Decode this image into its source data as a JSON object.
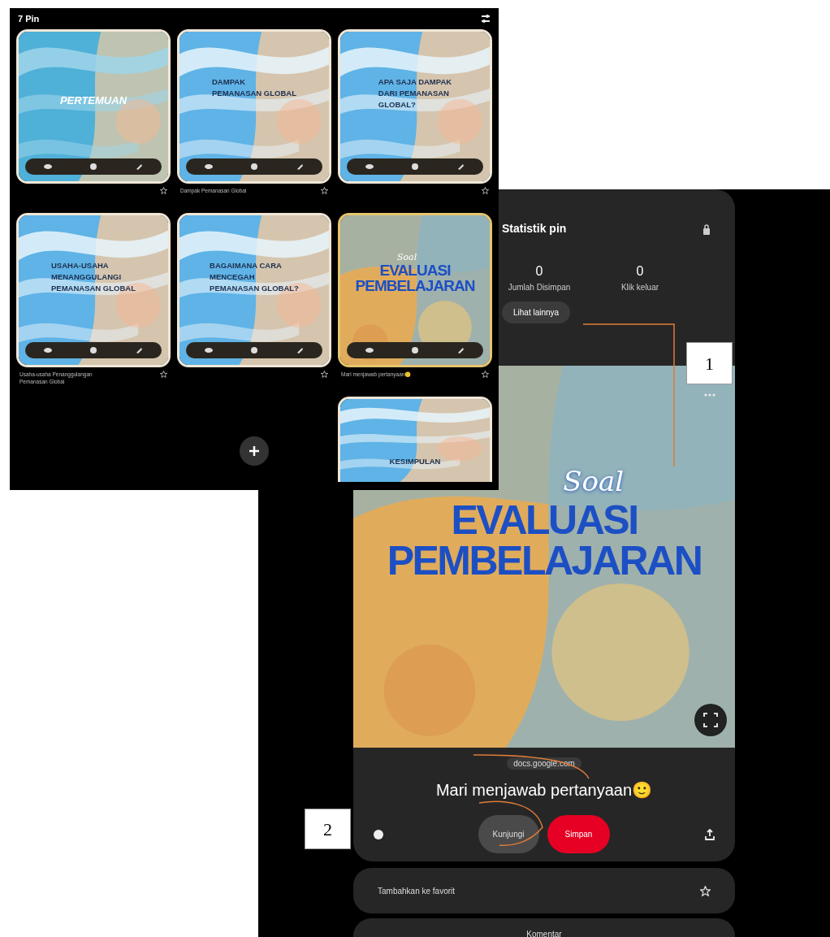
{
  "board": {
    "title": "7 Pin",
    "pins": [
      {
        "kind": "watercolor",
        "headline": [
          "PERTEMUAN"
        ]
      },
      {
        "kind": "waves",
        "headline": [
          "DAMPAK",
          "PEMANASAN GLOBAL"
        ],
        "caption": "Dampak Pemanasan Global"
      },
      {
        "kind": "waves",
        "headline": [
          "APA SAJA DAMPAK",
          "DARI PEMANASAN",
          "GLOBAL?"
        ]
      },
      {
        "kind": "waves",
        "headline": [
          "USAHA-USAHA",
          "MENANGGULANGI",
          "PEMANASAN GLOBAL"
        ],
        "caption": "Usaha-usaha Penanggulangan Pemanasan Global"
      },
      {
        "kind": "waves",
        "headline": [
          "BAGAIMANA CARA",
          "MENCEGAH",
          "PEMANASAN GLOBAL?"
        ]
      },
      {
        "kind": "sand",
        "headline": [
          "EVALUASI",
          "PEMBELAJARAN"
        ],
        "script": "Soal",
        "caption": "Mari menjawab pertanyaan🙂"
      },
      {
        "kind": "waves",
        "headline": [
          "KESIMPULAN"
        ],
        "cut_off": true
      }
    ]
  },
  "pin_detail": {
    "stats_title": "Statistik pin",
    "stats": [
      {
        "value": "0",
        "label": "Jumlah Disimpan"
      },
      {
        "value": "0",
        "label": "Klik keluar"
      }
    ],
    "more_button": "Lihat lainnya",
    "image": {
      "kind": "sand",
      "headline": [
        "EVALUASI",
        "PEMBELAJARAN"
      ],
      "script": "Soal"
    },
    "link": "docs.google.com",
    "title": "Mari menjawab pertanyaan🙂",
    "visit_button": "Kunjungi",
    "save_button": "Simpan",
    "favorite_row": "Tambahkan ke favorit",
    "comments_row": "Komentar"
  },
  "annotations": [
    {
      "label": "1"
    },
    {
      "label": "2"
    }
  ]
}
